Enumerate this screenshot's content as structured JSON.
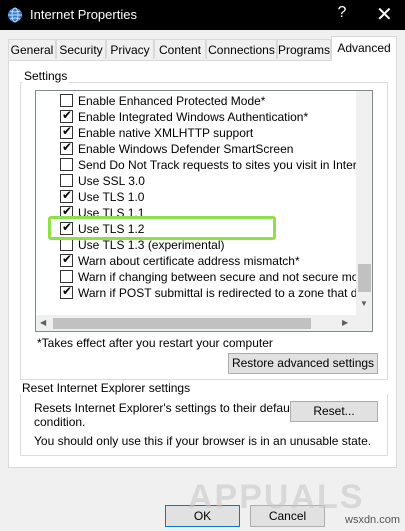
{
  "window": {
    "title": "Internet Properties",
    "help_glyph": "?",
    "close_glyph": "✕"
  },
  "tabs": [
    {
      "label": "General"
    },
    {
      "label": "Security"
    },
    {
      "label": "Privacy"
    },
    {
      "label": "Content"
    },
    {
      "label": "Connections"
    },
    {
      "label": "Programs"
    },
    {
      "label": "Advanced",
      "active": true
    }
  ],
  "settings": {
    "group_label": "Settings",
    "items": [
      {
        "label": "Enable Enhanced Protected Mode*",
        "checked": false
      },
      {
        "label": "Enable Integrated Windows Authentication*",
        "checked": true
      },
      {
        "label": "Enable native XMLHTTP support",
        "checked": true
      },
      {
        "label": "Enable Windows Defender SmartScreen",
        "checked": true
      },
      {
        "label": "Send Do Not Track requests to sites you visit in Internet E",
        "checked": false
      },
      {
        "label": "Use SSL 3.0",
        "checked": false
      },
      {
        "label": "Use TLS 1.0",
        "checked": true
      },
      {
        "label": "Use TLS 1.1",
        "checked": true
      },
      {
        "label": "Use TLS 1.2",
        "checked": true
      },
      {
        "label": "Use TLS 1.3 (experimental)",
        "checked": false
      },
      {
        "label": "Warn about certificate address mismatch*",
        "checked": true
      },
      {
        "label": "Warn if changing between secure and not secure mode",
        "checked": false
      },
      {
        "label": "Warn if POST submittal is redirected to a zone that does n",
        "checked": true
      }
    ],
    "restart_note": "*Takes effect after you restart your computer",
    "restore_button": "Restore advanced settings"
  },
  "reset": {
    "group_label": "Reset Internet Explorer settings",
    "description_line1": "Resets Internet Explorer's settings to their default",
    "description_line2": "condition.",
    "reset_button": "Reset...",
    "warning": "You should only use this if your browser is in an unusable state."
  },
  "footer": {
    "ok_button": "OK",
    "cancel_button": "Cancel"
  },
  "watermark": {
    "text": "APPUALS",
    "site": "wsxdn.com"
  }
}
